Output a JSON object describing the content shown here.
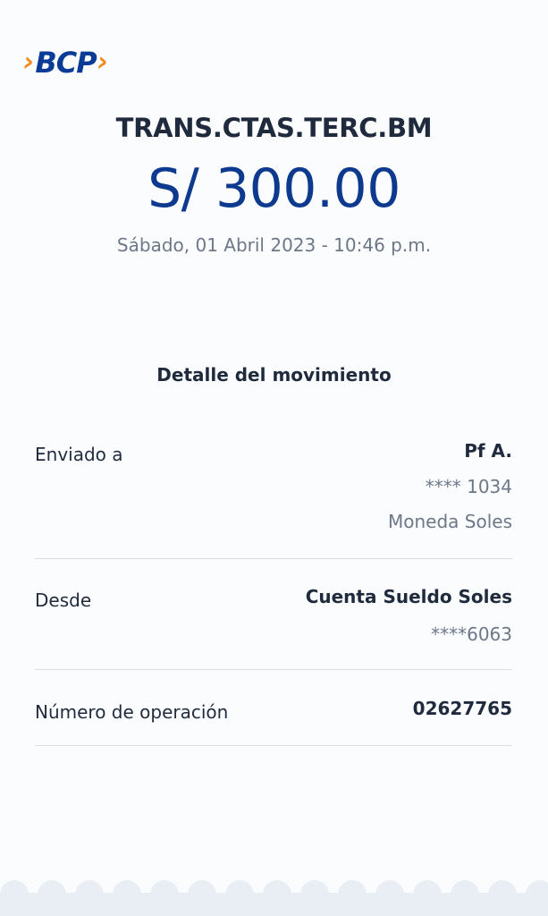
{
  "logo": {
    "text": "BCP",
    "left_chevron": "›",
    "right_chevron": "›",
    "colors": {
      "chevron": "#f28a1d",
      "text": "#0a3b96"
    }
  },
  "title": "TRANS.CTAS.TERC.BM",
  "amount": "S/ 300.00",
  "date": "Sábado, 01 Abril 2023 - 10:46 p.m.",
  "section_title": "Detalle del movimiento",
  "details": {
    "sent_to": {
      "label": "Enviado a",
      "name": "Pf A.",
      "account": "**** 1034",
      "currency": "Moneda Soles"
    },
    "from": {
      "label": "Desde",
      "account_name": "Cuenta Sueldo Soles",
      "account_number": "****6063"
    },
    "operation": {
      "label": "Número de operación",
      "number": "02627765"
    }
  },
  "colors": {
    "amount": "#0d3a8f",
    "text": "#1f2b3d",
    "muted": "#6c7888",
    "background": "#fbfcfe",
    "footer": "#e9eef4"
  }
}
